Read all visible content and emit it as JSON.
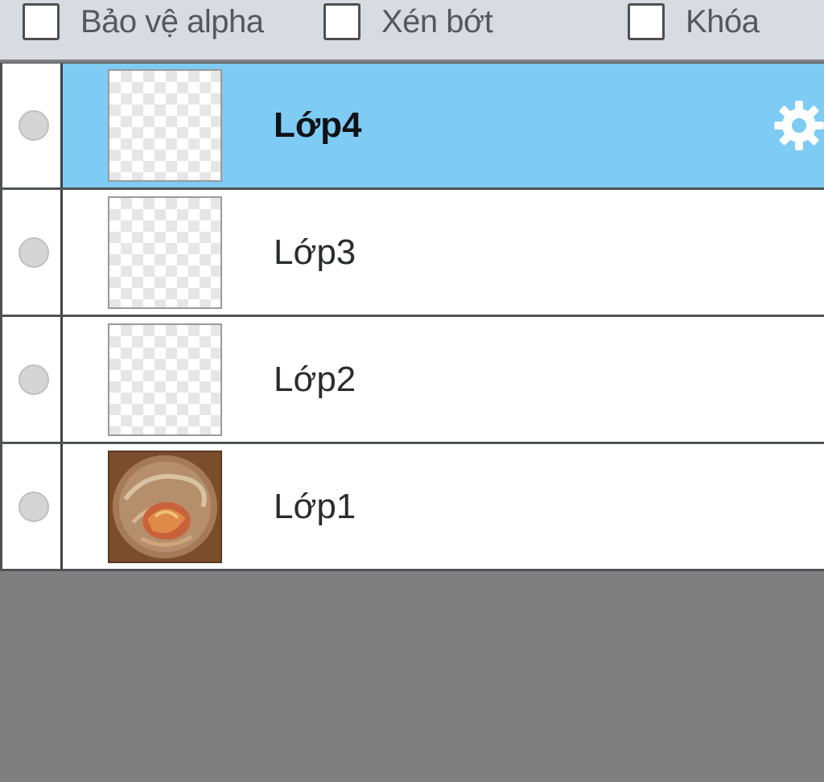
{
  "options": {
    "alpha_protect": {
      "label": "Bảo vệ alpha",
      "checked": false
    },
    "clipping": {
      "label": "Xén bớt",
      "checked": false
    },
    "lock": {
      "label": "Khóa",
      "checked": false
    }
  },
  "layers": [
    {
      "name": "Lớp4",
      "selected": true,
      "thumbnail": "transparent",
      "icon": "gear-icon"
    },
    {
      "name": "Lớp3",
      "selected": false,
      "thumbnail": "transparent"
    },
    {
      "name": "Lớp2",
      "selected": false,
      "thumbnail": "transparent"
    },
    {
      "name": "Lớp1",
      "selected": false,
      "thumbnail": "painted"
    }
  ],
  "colors": {
    "selected_row": "#7ecbf4",
    "toolbar_bg": "#d8dbdf",
    "empty_area": "#7f7f7f"
  }
}
